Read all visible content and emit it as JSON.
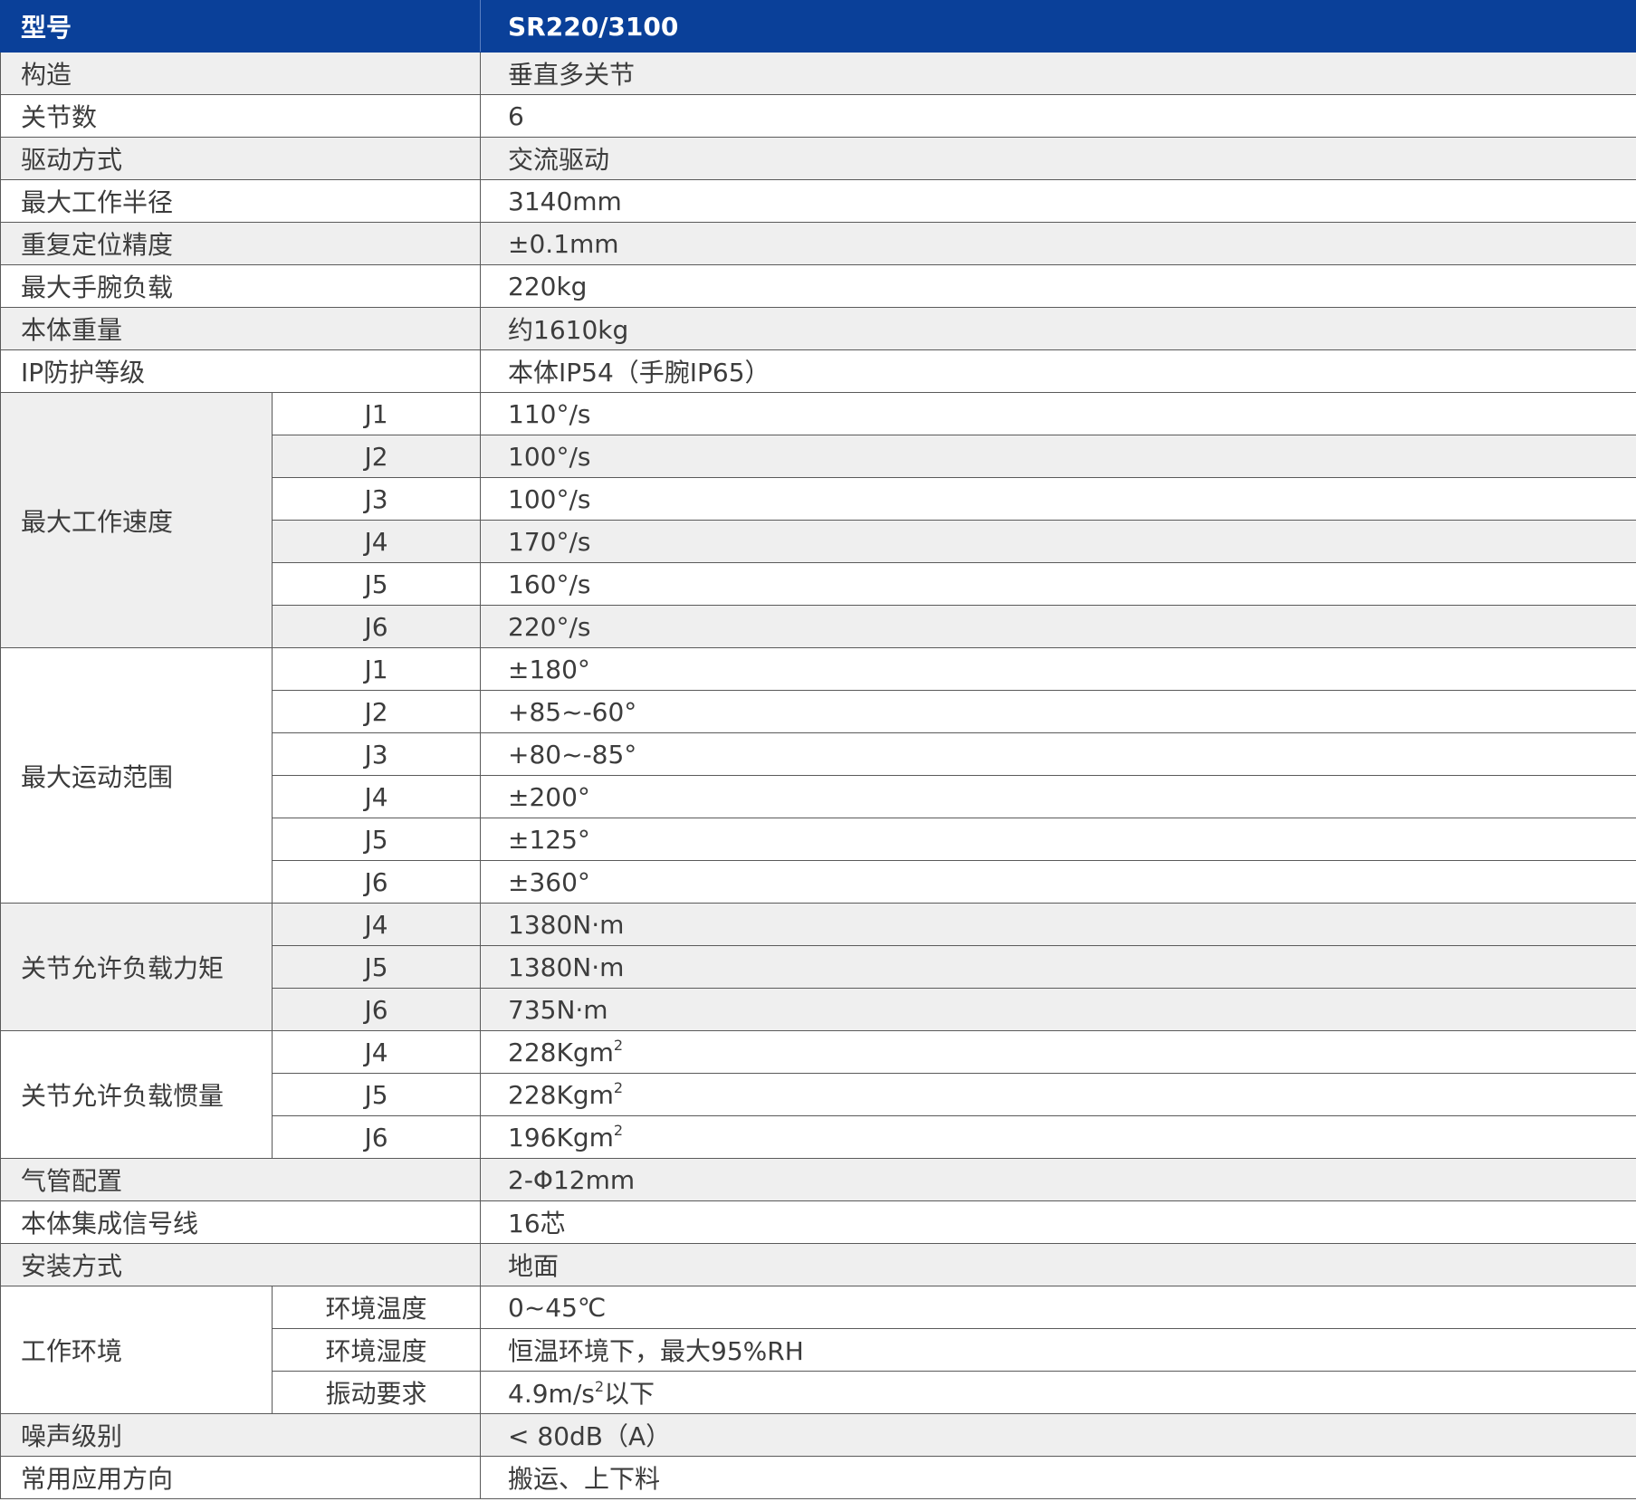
{
  "header": {
    "label": "型号",
    "model": "SR220/3100"
  },
  "simple_rows_top": [
    {
      "label": "构造",
      "value": "垂直多关节",
      "shade": "gray"
    },
    {
      "label": "关节数",
      "value": "6",
      "shade": "white"
    },
    {
      "label": "驱动方式",
      "value": "交流驱动",
      "shade": "gray"
    },
    {
      "label": "最大工作半径",
      "value": "3140mm",
      "shade": "white"
    },
    {
      "label": "重复定位精度",
      "value": "±0.1mm",
      "shade": "gray"
    },
    {
      "label": "最大手腕负载",
      "value": "220kg",
      "shade": "white"
    },
    {
      "label": "本体重量",
      "value": "约1610kg",
      "shade": "gray"
    },
    {
      "label": "IP防护等级",
      "value": "本体IP54（手腕IP65）",
      "shade": "white"
    }
  ],
  "max_speed": {
    "label": "最大工作速度",
    "rows": [
      {
        "joint": "J1",
        "value": "110°/s",
        "shade": "white"
      },
      {
        "joint": "J2",
        "value": "100°/s",
        "shade": "gray"
      },
      {
        "joint": "J3",
        "value": "100°/s",
        "shade": "white"
      },
      {
        "joint": "J4",
        "value": "170°/s",
        "shade": "gray"
      },
      {
        "joint": "J5",
        "value": "160°/s",
        "shade": "white"
      },
      {
        "joint": "J6",
        "value": "220°/s",
        "shade": "gray"
      }
    ]
  },
  "motion_range": {
    "label": "最大运动范围",
    "rows": [
      {
        "joint": "J1",
        "value": "±180°",
        "shade": "white"
      },
      {
        "joint": "J2",
        "value": "+85~-60°",
        "shade": "white"
      },
      {
        "joint": "J3",
        "value": "+80~-85°",
        "shade": "white"
      },
      {
        "joint": "J4",
        "value": "±200°",
        "shade": "white"
      },
      {
        "joint": "J5",
        "value": "±125°",
        "shade": "white"
      },
      {
        "joint": "J6",
        "value": "±360°",
        "shade": "white"
      }
    ]
  },
  "torque": {
    "label": "关节允许负载力矩",
    "rows": [
      {
        "joint": "J4",
        "value": "1380N·m",
        "shade": "gray"
      },
      {
        "joint": "J5",
        "value": "1380N·m",
        "shade": "gray"
      },
      {
        "joint": "J6",
        "value": "735N·m",
        "shade": "gray"
      }
    ]
  },
  "inertia": {
    "label": "关节允许负载惯量",
    "sup": "2",
    "rows": [
      {
        "joint": "J4",
        "value": "228Kgm",
        "shade": "white"
      },
      {
        "joint": "J5",
        "value": "228Kgm",
        "shade": "white"
      },
      {
        "joint": "J6",
        "value": "196Kgm",
        "shade": "white"
      }
    ]
  },
  "simple_rows_mid": [
    {
      "label": "气管配置",
      "value": "2-Φ12mm",
      "shade": "gray"
    },
    {
      "label": "本体集成信号线",
      "value": "16芯",
      "shade": "white"
    },
    {
      "label": "安装方式",
      "value": "地面",
      "shade": "gray"
    }
  ],
  "environment": {
    "label": "工作环境",
    "rows": [
      {
        "item": "环境温度",
        "value": "0~45℃"
      },
      {
        "item": "环境湿度",
        "value": "恒温环境下，最大95%RH"
      },
      {
        "item": "振动要求",
        "value_pre": "4.9m/s",
        "value_sup": "2",
        "value_post": "以下"
      }
    ]
  },
  "simple_rows_bottom": [
    {
      "label": "噪声级别",
      "value": "< 80dB（A）",
      "shade": "gray"
    },
    {
      "label": "常用应用方向",
      "value": "搬运、上下料",
      "shade": "white"
    }
  ],
  "colors": {
    "header_bg": "#0a4099",
    "gray_row": "#efefef",
    "border": "#5a5a5a",
    "text": "#3c3c3c"
  }
}
